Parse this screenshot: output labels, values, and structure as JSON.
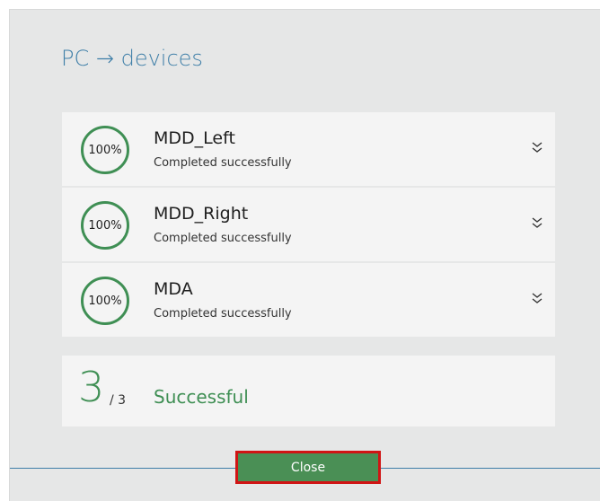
{
  "dialog": {
    "title": "PC → devices"
  },
  "devices": [
    {
      "name": "MDD_Left",
      "progress": "100%",
      "status": "Completed successfully"
    },
    {
      "name": "MDD_Right",
      "progress": "100%",
      "status": "Completed successfully"
    },
    {
      "name": "MDA",
      "progress": "100%",
      "status": "Completed successfully"
    }
  ],
  "summary": {
    "count": "3",
    "total": "/ 3",
    "label": "Successful"
  },
  "footer": {
    "close_label": "Close"
  },
  "colors": {
    "accent_blue": "#3f7fa8",
    "success_green": "#3f8f54",
    "button_green": "#4a8f55",
    "highlight_red": "#d01414",
    "dialog_bg": "#e6e7e7",
    "row_bg": "#f4f4f4"
  },
  "icons": {
    "expand": "double-chevron-down-icon"
  }
}
